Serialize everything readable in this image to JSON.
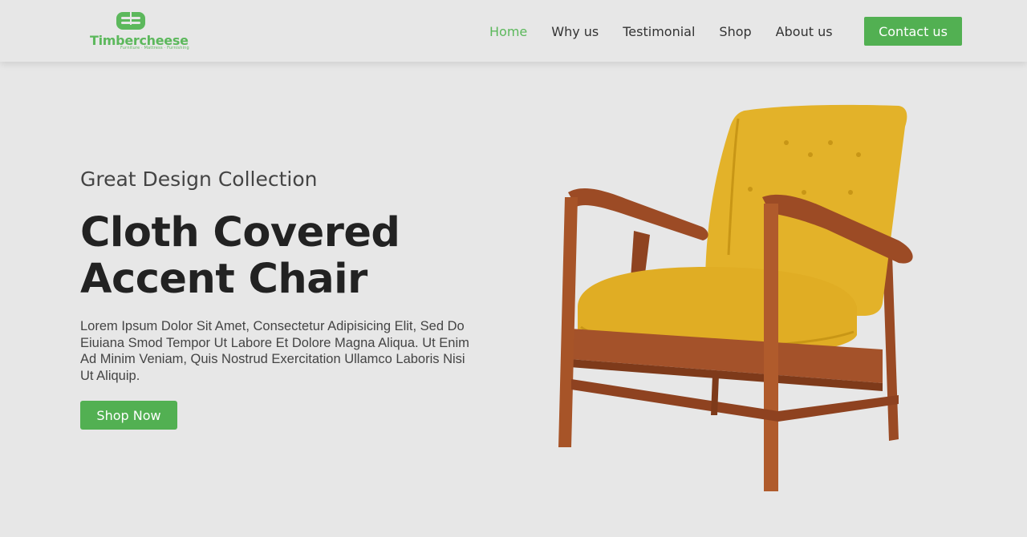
{
  "brand": {
    "name": "Timbercheese",
    "tagline": "Furniture · Mattress · Furnishing"
  },
  "nav": {
    "items": [
      {
        "label": "Home",
        "active": true
      },
      {
        "label": "Why us",
        "active": false
      },
      {
        "label": "Testimonial",
        "active": false
      },
      {
        "label": "Shop",
        "active": false
      },
      {
        "label": "About us",
        "active": false
      }
    ],
    "contact_label": "Contact us"
  },
  "hero": {
    "subtitle": "Great Design Collection",
    "title": "Cloth Covered Accent Chair",
    "description": "Lorem Ipsum Dolor Sit Amet, Consectetur Adipisicing Elit, Sed Do Eiuiana Smod Tempor Ut Labore Et Dolore Magna Aliqua. Ut Enim Ad Minim Veniam, Quis Nostrud Exercitation Ullamco Laboris Nisi Ut Aliquip.",
    "cta_label": "Shop Now"
  },
  "colors": {
    "accent": "#52b052",
    "background": "#e7e7e7",
    "chair_fabric": "#e3b229",
    "chair_wood": "#a4522a"
  }
}
